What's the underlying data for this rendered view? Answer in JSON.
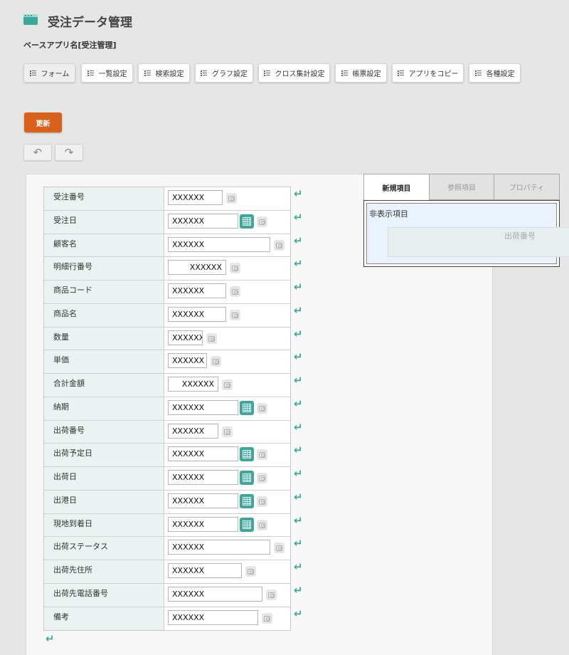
{
  "header": {
    "title": "受注データ管理",
    "subtitle": "ベースアプリ名[受注管理]"
  },
  "toolbar": {
    "buttons": [
      {
        "label": "フォーム",
        "active": true
      },
      {
        "label": "一覧設定"
      },
      {
        "label": "検索設定"
      },
      {
        "label": "グラフ設定"
      },
      {
        "label": "クロス集計設定"
      },
      {
        "label": "帳票設定"
      },
      {
        "label": "アプリをコピー"
      },
      {
        "label": "各種設定"
      }
    ]
  },
  "actions": {
    "update_label": "更新",
    "undo_symbol": "↶",
    "redo_symbol": "↷"
  },
  "form": {
    "fields": [
      {
        "label": "受注番号",
        "value": "XXXXXX",
        "type": "text"
      },
      {
        "label": "受注日",
        "value": "XXXXXX",
        "type": "date"
      },
      {
        "label": "顧客名",
        "value": "XXXXXX",
        "type": "text"
      },
      {
        "label": "明細行番号",
        "value": "XXXXXX",
        "type": "number"
      },
      {
        "label": "商品コード",
        "value": "XXXXXX",
        "type": "text"
      },
      {
        "label": "商品名",
        "value": "XXXXXX",
        "type": "text"
      },
      {
        "label": "数量",
        "value": "XXXXXX",
        "type": "number"
      },
      {
        "label": "単価",
        "value": "XXXXXX",
        "type": "number"
      },
      {
        "label": "合計金額",
        "value": "XXXXXX",
        "type": "number"
      },
      {
        "label": "納期",
        "value": "XXXXXX",
        "type": "date"
      },
      {
        "label": "出荷番号",
        "value": "XXXXXX",
        "type": "text"
      },
      {
        "label": "出荷予定日",
        "value": "XXXXXX",
        "type": "date"
      },
      {
        "label": "出荷日",
        "value": "XXXXXX",
        "type": "date"
      },
      {
        "label": "出港日",
        "value": "XXXXXX",
        "type": "date"
      },
      {
        "label": "現地到着日",
        "value": "XXXXXX",
        "type": "date"
      },
      {
        "label": "出荷ステータス",
        "value": "XXXXXX",
        "type": "text"
      },
      {
        "label": "出荷先住所",
        "value": "XXXXXX",
        "type": "text"
      },
      {
        "label": "出荷先電話番号",
        "value": "XXXXXX",
        "type": "text"
      },
      {
        "label": "備考",
        "value": "XXXXXX",
        "type": "text"
      }
    ],
    "return_symbol": "↵"
  },
  "side_panel": {
    "tabs": [
      {
        "label": "新規項目",
        "active": true
      },
      {
        "label": "参照項目"
      },
      {
        "label": "プロパティ"
      }
    ],
    "hidden_section_title": "非表示項目",
    "hidden_items": [
      "出荷番号"
    ]
  },
  "colors": {
    "accent": "#3aa89a",
    "update_button": "#d9611c",
    "background": "#e6e6e6",
    "label_cell": "#eaf3f2"
  },
  "icons": {
    "app": "window-icon",
    "toolbar": "list-icon",
    "date": "calendar-icon",
    "attachment": "camera-icon",
    "line_break": "return-arrow-icon"
  }
}
